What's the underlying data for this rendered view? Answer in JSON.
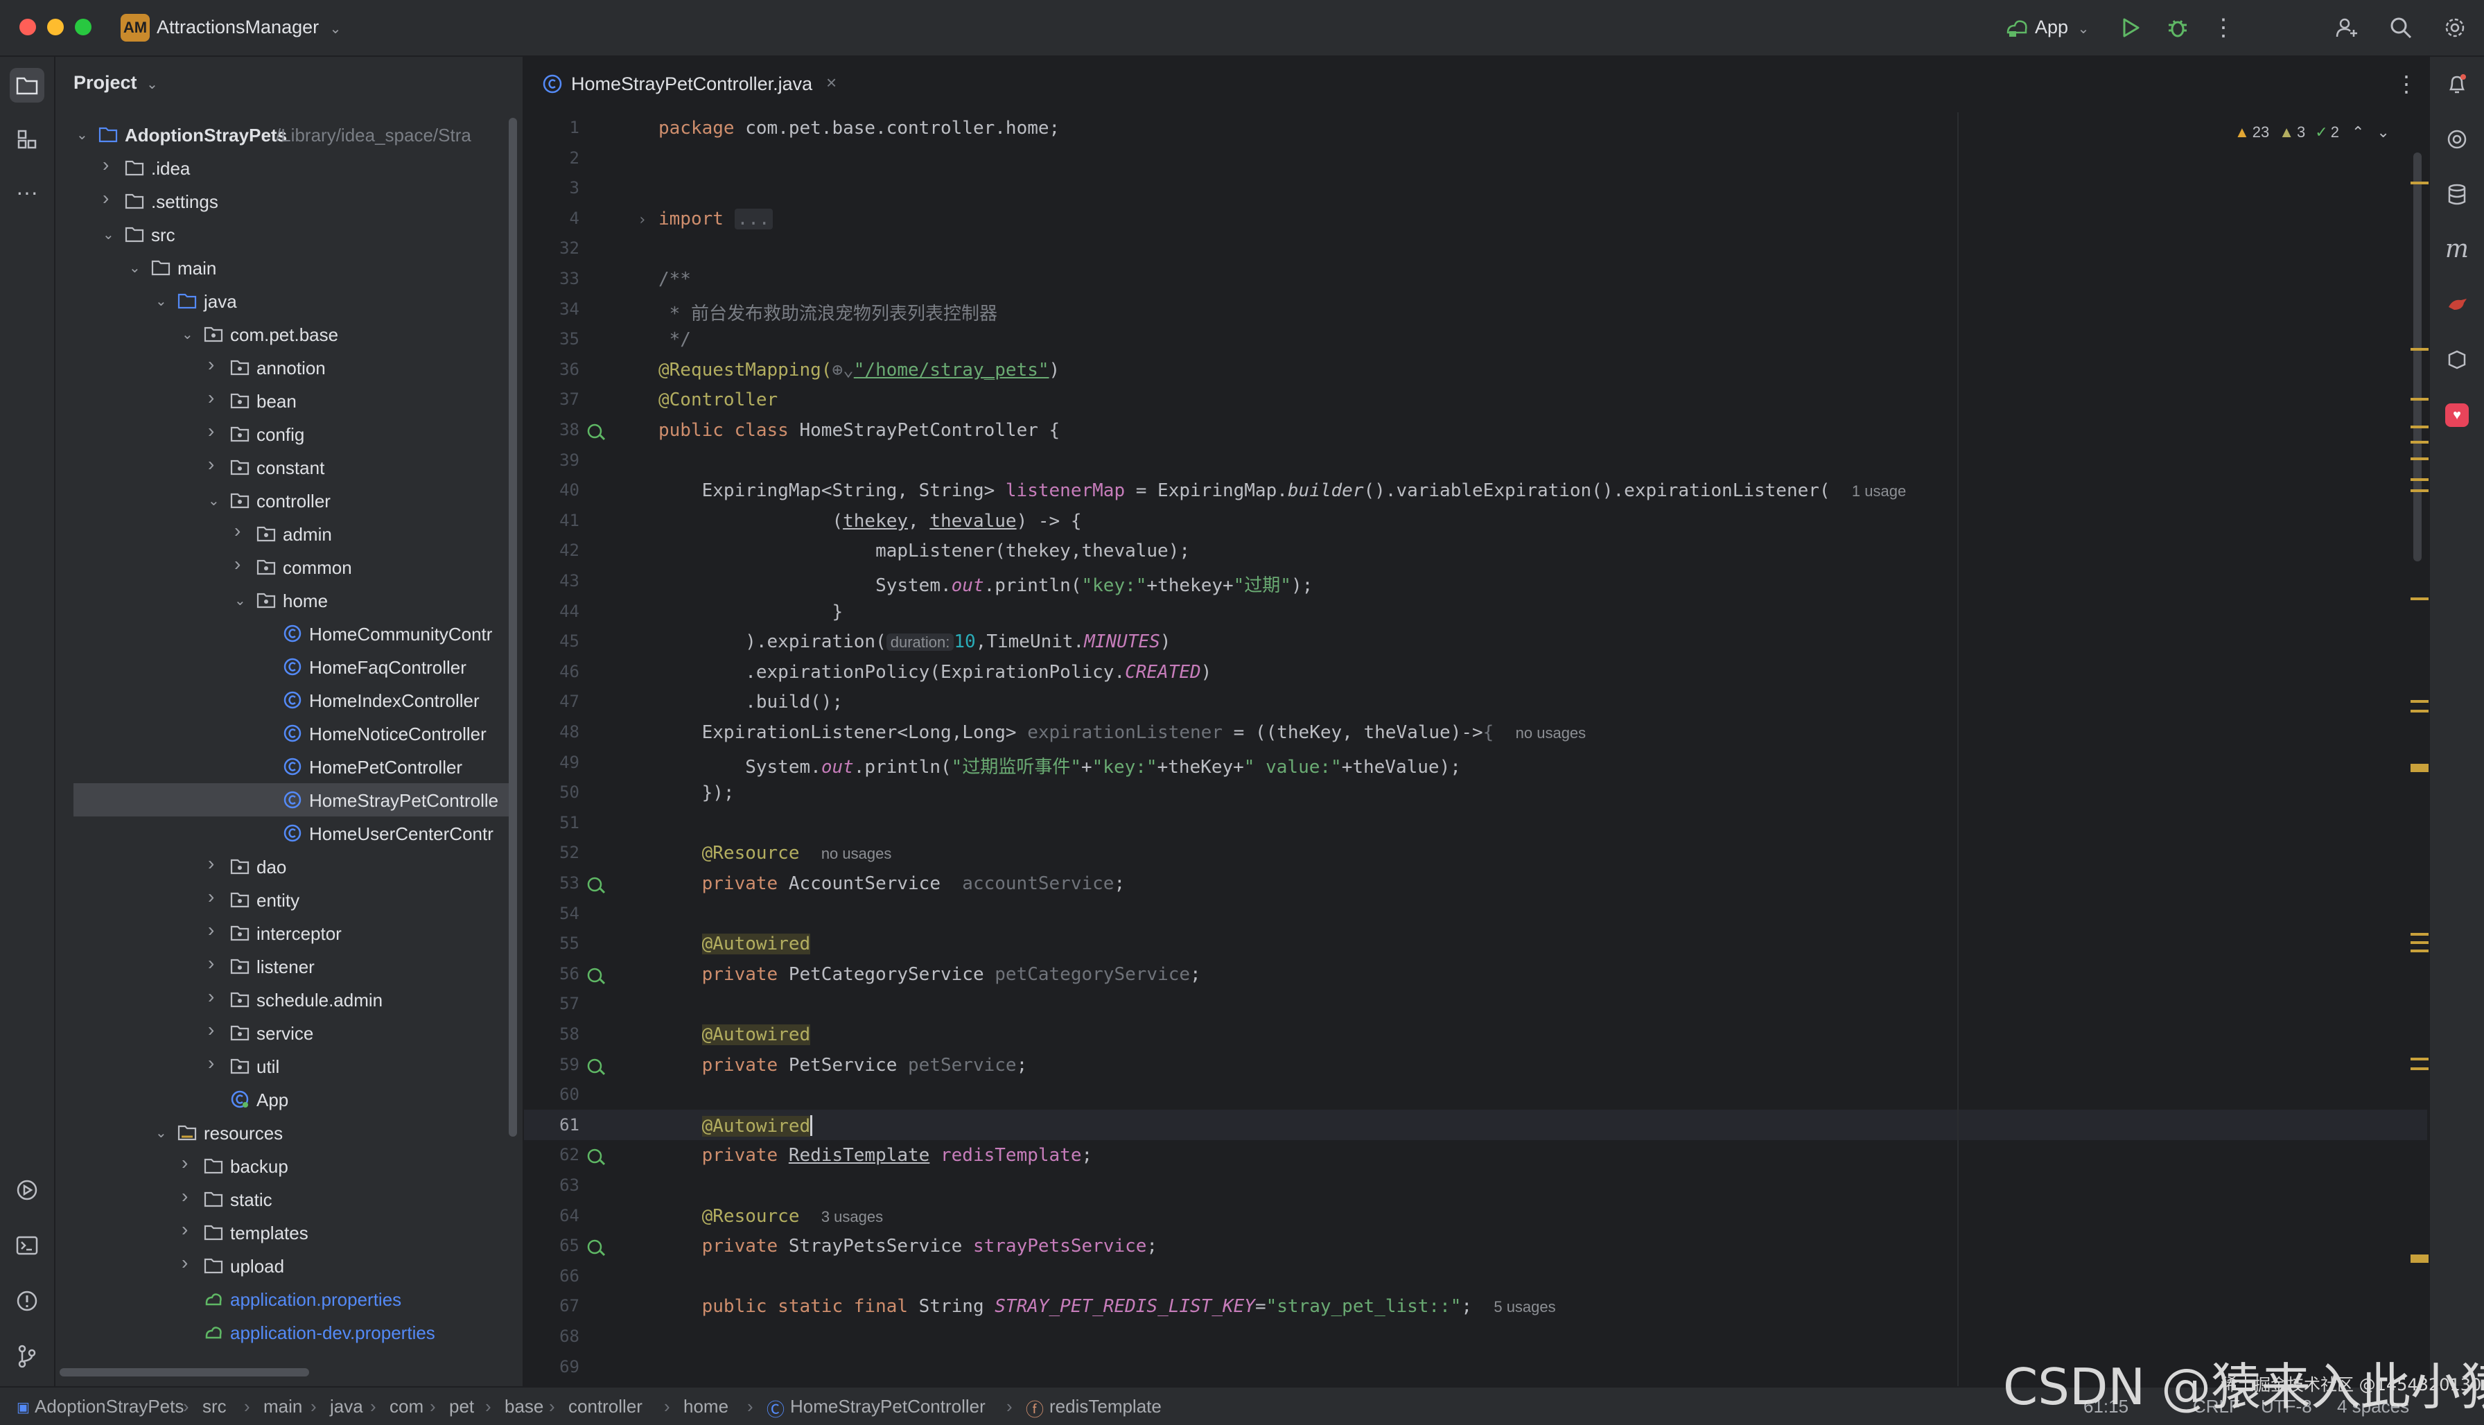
{
  "window": {
    "project_badge": "AM",
    "project_name": "AttractionsManager",
    "run_config": "App"
  },
  "project_panel": {
    "title": "Project",
    "root_name": "AdoptionStrayPets",
    "root_path": "/Library/idea_space/Stra",
    "items": [
      {
        "label": ".idea",
        "type": "folder"
      },
      {
        "label": ".settings",
        "type": "folder"
      },
      {
        "label": "src",
        "type": "folder"
      },
      {
        "label": "main",
        "type": "folder"
      },
      {
        "label": "java",
        "type": "folder-src"
      },
      {
        "label": "com.pet.base",
        "type": "package"
      },
      {
        "label": "annotion",
        "type": "package"
      },
      {
        "label": "bean",
        "type": "package"
      },
      {
        "label": "config",
        "type": "package"
      },
      {
        "label": "constant",
        "type": "package"
      },
      {
        "label": "controller",
        "type": "package"
      },
      {
        "label": "admin",
        "type": "package"
      },
      {
        "label": "common",
        "type": "package"
      },
      {
        "label": "home",
        "type": "package"
      },
      {
        "label": "HomeCommunityContr",
        "type": "class"
      },
      {
        "label": "HomeFaqController",
        "type": "class"
      },
      {
        "label": "HomeIndexController",
        "type": "class"
      },
      {
        "label": "HomeNoticeController",
        "type": "class"
      },
      {
        "label": "HomePetController",
        "type": "class"
      },
      {
        "label": "HomeStrayPetControlle",
        "type": "class"
      },
      {
        "label": "HomeUserCenterContr",
        "type": "class"
      },
      {
        "label": "dao",
        "type": "package"
      },
      {
        "label": "entity",
        "type": "package"
      },
      {
        "label": "interceptor",
        "type": "package"
      },
      {
        "label": "listener",
        "type": "package"
      },
      {
        "label": "schedule.admin",
        "type": "package"
      },
      {
        "label": "service",
        "type": "package"
      },
      {
        "label": "util",
        "type": "package"
      },
      {
        "label": "App",
        "type": "app"
      },
      {
        "label": "resources",
        "type": "folder-res"
      },
      {
        "label": "backup",
        "type": "folder"
      },
      {
        "label": "static",
        "type": "folder"
      },
      {
        "label": "templates",
        "type": "folder"
      },
      {
        "label": "upload",
        "type": "folder"
      },
      {
        "label": "application.properties",
        "type": "props"
      },
      {
        "label": "application-dev.properties",
        "type": "props"
      }
    ]
  },
  "editor": {
    "tab_title": "HomeStrayPetController.java",
    "inspections": {
      "warnings": "23",
      "weak_warnings": "3",
      "ok": "2"
    },
    "line_numbers": [
      "1",
      "2",
      "3",
      "4",
      "32",
      "33",
      "34",
      "35",
      "36",
      "37",
      "38",
      "39",
      "40",
      "41",
      "42",
      "43",
      "44",
      "45",
      "46",
      "47",
      "48",
      "49",
      "50",
      "51",
      "52",
      "53",
      "54",
      "55",
      "56",
      "57",
      "58",
      "59",
      "60",
      "61",
      "62",
      "63",
      "64",
      "65",
      "66",
      "67",
      "68",
      "69"
    ],
    "code": {
      "package_kw": "package",
      "package_name": " com.pet.base.controller.home;",
      "import_kw": "import",
      "import_folded": "...",
      "doc_open": "/**",
      "doc_text": " * 前台发布救助流浪宠物列表列表控制器",
      "doc_close": " */",
      "req_mapping": "@RequestMapping(",
      "req_globe": "⊕⌄",
      "req_path": "\"/home/stray_pets\"",
      "req_close": ")",
      "controller_ann": "@Controller",
      "class_decl_kw": "public class",
      "class_decl_name": " HomeStrayPetController {",
      "l40_a": "    ExpiringMap<String, String> ",
      "l40_field": "listenerMap",
      "l40_b": " = ExpiringMap.",
      "l40_builder": "builder",
      "l40_c": "().variableExpiration().expirationListener(",
      "l40_hint": "1 usage",
      "l41_a": "                (",
      "l41_k": "thekey",
      "l41_sep": ", ",
      "l41_v": "thevalue",
      "l41_b": ") -> {",
      "l42": "                    mapListener(thekey,thevalue);",
      "l43_a": "                    System.",
      "l43_out": "out",
      "l43_b": ".println(",
      "l43_s1": "\"key:\"",
      "l43_c": "+thekey+",
      "l43_s2": "\"过期\"",
      "l43_d": ");",
      "l44": "                }",
      "l45_a": "        ).expiration(",
      "l45_hint": "duration:",
      "l45_num": "10",
      "l45_b": ",TimeUnit.",
      "l45_const": "MINUTES",
      "l45_c": ")",
      "l46_a": "        .expirationPolicy(ExpirationPolicy.",
      "l46_const": "CREATED",
      "l46_b": ")",
      "l47": "        .build();",
      "l48_a": "    ExpirationListener<Long,Long> ",
      "l48_var": "expirationListener",
      "l48_b": " = ((theKey, theValue)->",
      "l48_brace": "{",
      "l48_hint": "no usages",
      "l49_a": "        System.",
      "l49_out": "out",
      "l49_b": ".println(",
      "l49_s1": "\"过期监听事件\"",
      "l49_c": "+",
      "l49_s2": "\"key:\"",
      "l49_d": "+theKey+",
      "l49_s3": "\" value:\"",
      "l49_e": "+theValue);",
      "l50": "    });",
      "l52_ann": "    @Resource",
      "l52_hint": "no usages",
      "l53_kw": "    private",
      "l53_type": " AccountService ",
      "l53_var": " accountService",
      "l53_end": ";",
      "l55_ann": "@Autowired",
      "l56_kw": "    private",
      "l56_type": " PetCategoryService ",
      "l56_var": "petCategoryService",
      "l56_end": ";",
      "l58_ann": "@Autowired",
      "l59_kw": "    private",
      "l59_type": " PetService ",
      "l59_var": "petService",
      "l59_end": ";",
      "l61_ann": "@Autowired",
      "l62_kw": "    private",
      "l62_type": "RedisTemplate",
      "l62_var": "redisTemplate",
      "l62_end": ";",
      "l64_ann": "    @Resource",
      "l64_hint": "3 usages",
      "l65_kw": "    private",
      "l65_type": " StrayPetsService ",
      "l65_var": "strayPetsService",
      "l65_end": ";",
      "l67_kw": "    public static final",
      "l67_type": " String ",
      "l67_const": "STRAY_PET_REDIS_LIST_KEY",
      "l67_eq": "=",
      "l67_str": "\"stray_pet_list::\"",
      "l67_end": ";",
      "l67_hint": "5 usages"
    }
  },
  "status_bar": {
    "breadcrumbs": [
      "AdoptionStrayPets",
      "src",
      "main",
      "java",
      "com",
      "pet",
      "base",
      "controller",
      "home",
      "HomeStrayPetController",
      "redisTemplate"
    ],
    "position": "61:15",
    "line_sep": "CRLF",
    "encoding": "UTF-8",
    "indent": "4 spaces"
  },
  "watermark": "CSDN @猿来入此小猿",
  "watermark_small": "稀土掘金技术社区 @1454320130",
  "colors": {
    "accent": "#3574f0",
    "keyword": "#cf8e6d",
    "annotation": "#b3ae60",
    "string": "#6aab73",
    "field": "#c77dbb",
    "warning": "#c9a13b"
  }
}
